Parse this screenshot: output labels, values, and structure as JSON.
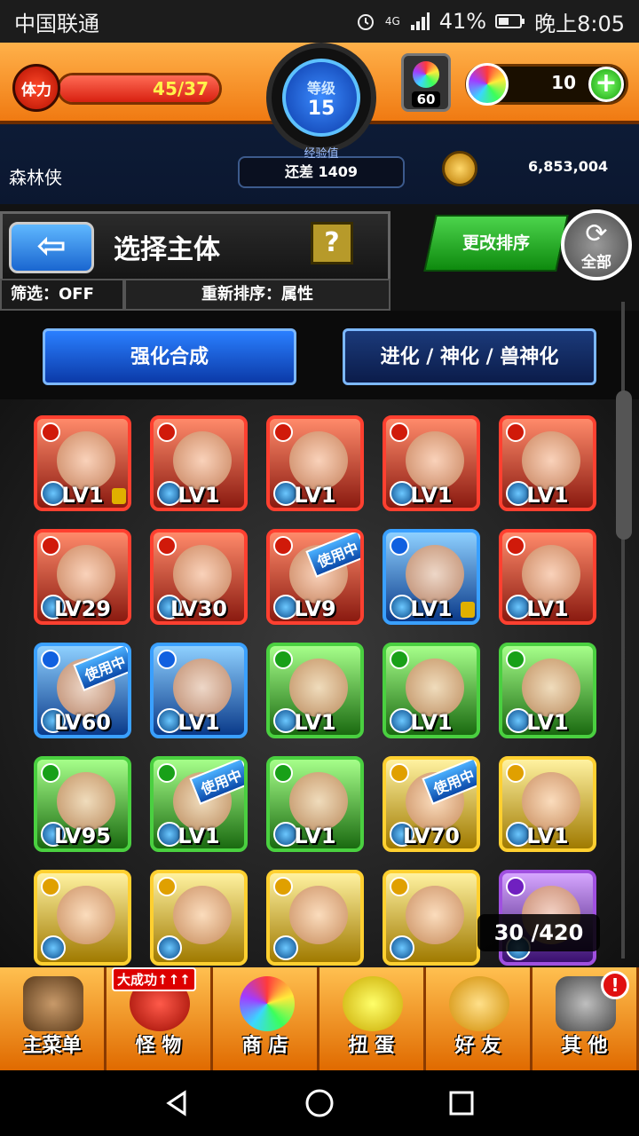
{
  "status_bar": {
    "carrier": "中国联通",
    "network": "4G",
    "battery": "41%",
    "time": "晚上8:05"
  },
  "hud": {
    "stamina_label": "体力",
    "stamina_value": "45/37",
    "stamina_fraction": 1.0,
    "level_label": "等级",
    "level_value": "15",
    "exp_label": "经验值",
    "exp_remaining": "还差 1409",
    "orb_chest_count": "60",
    "orb_count": "10",
    "plus_label": "+",
    "player_name": "森林侠",
    "gold": "6,853,004"
  },
  "header": {
    "back_label": "⇦",
    "title": "选择主体",
    "help_label": "?",
    "filter_label": "筛选：OFF",
    "reorder_label": "重新排序：属性",
    "sort_button": "更改排序",
    "all_button": "全部",
    "refresh_glyph": "⟳"
  },
  "tabs": {
    "active": "强化合成",
    "inactive": "进化 / 神化 / 兽神化"
  },
  "monsters": [
    {
      "attr": "fire",
      "level": "LV1",
      "locked": true,
      "in_use": false
    },
    {
      "attr": "fire",
      "level": "LV1",
      "locked": false,
      "in_use": false
    },
    {
      "attr": "fire",
      "level": "LV1",
      "locked": false,
      "in_use": false
    },
    {
      "attr": "fire",
      "level": "LV1",
      "locked": false,
      "in_use": false
    },
    {
      "attr": "fire",
      "level": "LV1",
      "locked": false,
      "in_use": false
    },
    {
      "attr": "fire",
      "level": "LV29",
      "locked": false,
      "in_use": false
    },
    {
      "attr": "fire",
      "level": "LV30",
      "locked": false,
      "in_use": false
    },
    {
      "attr": "fire",
      "level": "LV9",
      "locked": false,
      "in_use": true
    },
    {
      "attr": "water",
      "level": "LV1",
      "locked": true,
      "in_use": false
    },
    {
      "attr": "fire",
      "level": "LV1",
      "locked": false,
      "in_use": false
    },
    {
      "attr": "water",
      "level": "LV60",
      "locked": false,
      "in_use": true
    },
    {
      "attr": "water",
      "level": "LV1",
      "locked": false,
      "in_use": false
    },
    {
      "attr": "wood",
      "level": "LV1",
      "locked": false,
      "in_use": false
    },
    {
      "attr": "wood",
      "level": "LV1",
      "locked": false,
      "in_use": false
    },
    {
      "attr": "wood",
      "level": "LV1",
      "locked": false,
      "in_use": false
    },
    {
      "attr": "wood",
      "level": "LV95",
      "locked": false,
      "in_use": false
    },
    {
      "attr": "wood",
      "level": "LV1",
      "locked": false,
      "in_use": true
    },
    {
      "attr": "wood",
      "level": "LV1",
      "locked": false,
      "in_use": false
    },
    {
      "attr": "light",
      "level": "LV70",
      "locked": false,
      "in_use": true
    },
    {
      "attr": "light",
      "level": "LV1",
      "locked": false,
      "in_use": false
    },
    {
      "attr": "light",
      "level": "",
      "locked": false,
      "in_use": false
    },
    {
      "attr": "light",
      "level": "",
      "locked": false,
      "in_use": false
    },
    {
      "attr": "light",
      "level": "",
      "locked": false,
      "in_use": false
    },
    {
      "attr": "light",
      "level": "",
      "locked": false,
      "in_use": false
    },
    {
      "attr": "dark",
      "level": "",
      "locked": false,
      "in_use": false
    }
  ],
  "in_use_label": "使用中",
  "box_count": "30 /420",
  "bottom_nav": [
    {
      "label": "主菜单",
      "icon": "home-gate-icon",
      "cls": "ico-home"
    },
    {
      "label": "怪 物",
      "icon": "monster-icon",
      "cls": "ico-monster",
      "badge": "大成功↑↑↑"
    },
    {
      "label": "商 店",
      "icon": "rainbow-orb-icon",
      "cls": "ico-shop"
    },
    {
      "label": "扭 蛋",
      "icon": "egg-icon",
      "cls": "ico-gacha"
    },
    {
      "label": "好 友",
      "icon": "balloons-icon",
      "cls": "ico-friends"
    },
    {
      "label": "其 他",
      "icon": "signpost-icon",
      "cls": "ico-other",
      "notification": "!"
    }
  ],
  "android_nav": {
    "back": "◁",
    "home": "◯",
    "recents": "▢"
  }
}
